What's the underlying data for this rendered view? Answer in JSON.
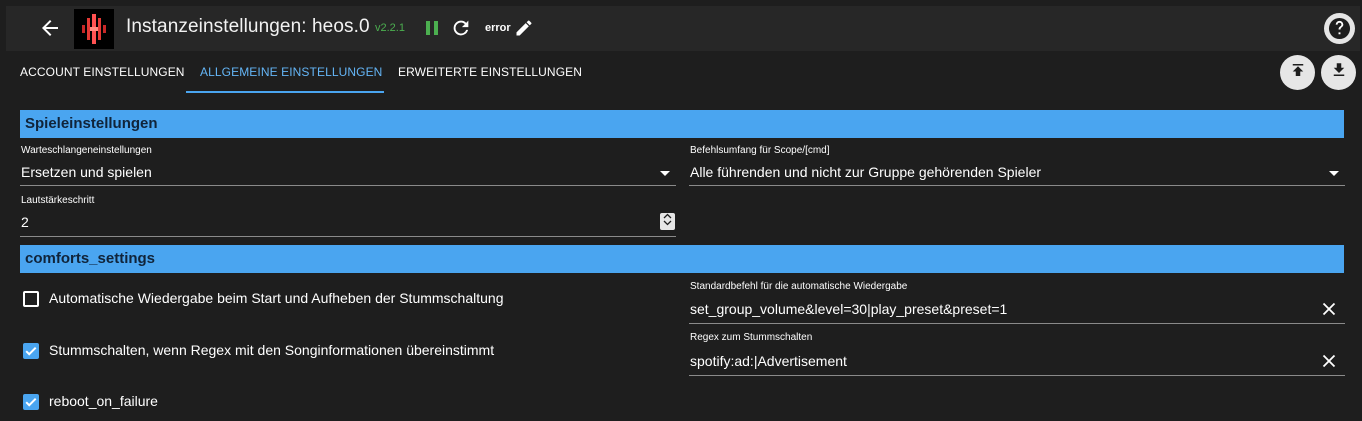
{
  "header": {
    "title": "Instanzeinstellungen: heos.0",
    "version": "v2.2.1",
    "status_label": "error",
    "colors": {
      "version": "#4caf50",
      "pause": "#4caf50",
      "accent": "#4aa5f0"
    },
    "icons": [
      "back-arrow-icon",
      "heos-logo-icon",
      "pause-icon",
      "reload-icon",
      "edit-pencil-icon",
      "help-icon"
    ]
  },
  "tabs": [
    {
      "label": "ACCOUNT EINSTELLUNGEN",
      "active": false
    },
    {
      "label": "ALLGEMEINE EINSTELLUNGEN",
      "active": true
    },
    {
      "label": "ERWEITERTE EINSTELLUNGEN",
      "active": false
    }
  ],
  "toolbar": {
    "icons": [
      "upload-icon",
      "download-icon"
    ]
  },
  "sections": {
    "player": {
      "title": "Spieleinstellungen",
      "queue": {
        "label": "Warteschlangeneinstellungen",
        "value": "Ersetzen und spielen"
      },
      "scope": {
        "label": "Befehlsumfang für Scope/[cmd]",
        "value": "Alle führenden und nicht zur Gruppe gehörenden Spieler"
      },
      "volume_step": {
        "label": "Lautstärkeschritt",
        "value": "2"
      }
    },
    "comforts": {
      "title": "comforts_settings",
      "autoplay": {
        "label": "Automatische Wiedergabe beim Start und Aufheben der Stummschaltung",
        "checked": false
      },
      "mute_regex_toggle": {
        "label": "Stummschalten, wenn Regex mit den Songinformationen übereinstimmt",
        "checked": true
      },
      "reboot": {
        "label": "reboot_on_failure",
        "checked": true
      },
      "autoplay_cmd": {
        "label": "Standardbefehl für die automatische Wiedergabe",
        "value": "set_group_volume&level=30|play_preset&preset=1"
      },
      "mute_regex": {
        "label": "Regex zum Stummschalten",
        "value": "spotify:ad:|Advertisement"
      }
    }
  }
}
